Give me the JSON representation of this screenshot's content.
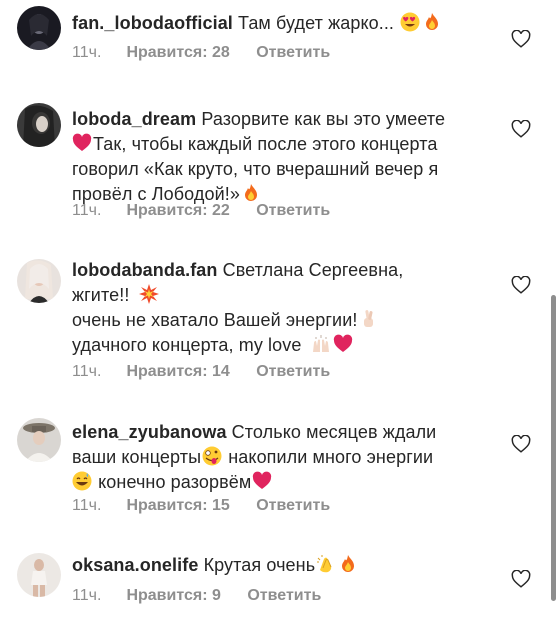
{
  "comments": [
    {
      "username": "fan._lobodaofficial",
      "text": "Там будет жарко...",
      "emoji_tail": [
        "heart-eyes-emoji",
        "fire-emoji"
      ],
      "time": "11ч.",
      "likes": "Нравится: 28",
      "reply": "Ответить"
    },
    {
      "username": "loboda_dream",
      "text_line1": "Разорвите как вы это умеете",
      "text_line2": "Так, чтобы каждый после этого концерта",
      "text_line3": "говорил «Как круто, что вчерашний вечер я",
      "text_line4": "провёл с Лободой!»",
      "time": "11ч.",
      "likes": "Нравится: 22",
      "reply": "Ответить"
    },
    {
      "username": "lobodabanda.fan",
      "text_line1": "Светлана Сергеевна,",
      "text_line2": "жгите!!",
      "text_line3": "очень не хватало Вашей энергии!",
      "text_line4": "удачного концерта, my love",
      "time": "11ч.",
      "likes": "Нравится: 14",
      "reply": "Ответить"
    },
    {
      "username": "elena_zyubanowa",
      "text_line1": "Столько месяцев ждали",
      "text_line2": "ваши концерты",
      "text_line2b": "накопили много энергии",
      "text_line3": "конечно разорвём",
      "time": "11ч.",
      "likes": "Нравится: 15",
      "reply": "Ответить"
    },
    {
      "username": "oksana.onelife",
      "text": "Крутая очень",
      "time": "11ч.",
      "likes": "Нравится: 9",
      "reply": "Ответить"
    }
  ],
  "colors": {
    "text": "#262626",
    "meta": "#8e8e8e",
    "heart": "#e0245e",
    "fire": "#f36b1c"
  }
}
